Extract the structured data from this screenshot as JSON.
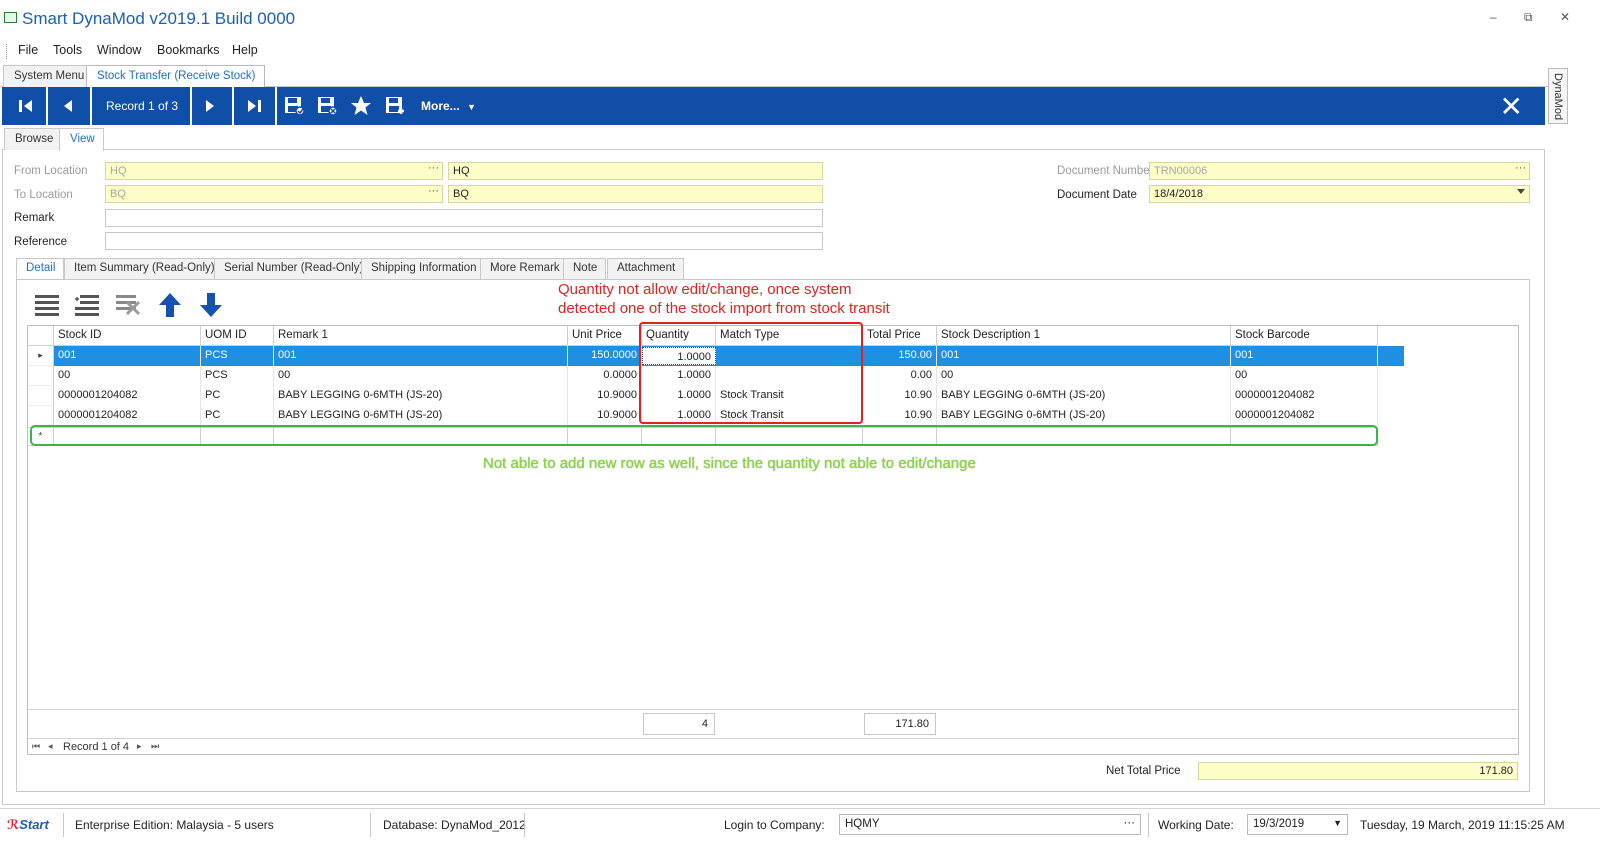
{
  "window": {
    "title": "Smart DynaMod v2019.1 Build 0000",
    "controls": "– ⧉ ✕"
  },
  "menu": [
    "File",
    "Tools",
    "Window",
    "Bookmarks",
    "Help"
  ],
  "doc_tabs": [
    "System Menu",
    "Stock Transfer (Receive Stock)"
  ],
  "side_tab": "DynaMod",
  "toolbar": {
    "record_label": "Record 1 of 3",
    "more_label": "More...",
    "icons": [
      "first-record-icon",
      "prev-record-icon",
      "next-record-icon",
      "last-record-icon",
      "save-icon",
      "save-close-icon",
      "bookmark-star-icon",
      "save-new-icon",
      "close-icon"
    ]
  },
  "view_tabs": [
    "Browse",
    "View"
  ],
  "form": {
    "from_location_label": "From Location",
    "from_location_code": "HQ",
    "from_location_name": "HQ",
    "to_location_label": "To Location",
    "to_location_code": "BQ",
    "to_location_name": "BQ",
    "remark_label": "Remark",
    "remark_value": "",
    "reference_label": "Reference",
    "reference_value": "",
    "doc_number_label": "Document Number",
    "doc_number_value": "TRN00006",
    "doc_date_label": "Document Date",
    "doc_date_value": "18/4/2018"
  },
  "detail_tabs": [
    "Detail",
    "Item Summary (Read-Only)",
    "Serial Number (Read-Only)",
    "Shipping Information",
    "More Remark",
    "Note",
    "Attachment"
  ],
  "grid": {
    "columns": [
      "Stock ID",
      "UOM ID",
      "Remark 1",
      "Unit Price",
      "Quantity",
      "Match Type",
      "Total Price",
      "Stock Description 1",
      "Stock Barcode"
    ],
    "rows": [
      [
        "001",
        "PCS",
        "001",
        "150.0000",
        "1.0000",
        "",
        "150.00",
        "001",
        "001"
      ],
      [
        "00",
        "PCS",
        "00",
        "0.0000",
        "1.0000",
        "",
        "0.00",
        "00",
        "00"
      ],
      [
        "0000001204082",
        "PC",
        "BABY LEGGING 0-6MTH (JS-20)",
        "10.9000",
        "1.0000",
        "Stock Transit",
        "10.90",
        "BABY LEGGING 0-6MTH (JS-20)",
        "0000001204082"
      ],
      [
        "0000001204082",
        "PC",
        "BABY LEGGING 0-6MTH (JS-20)",
        "10.9000",
        "1.0000",
        "Stock Transit",
        "10.90",
        "BABY LEGGING 0-6MTH (JS-20)",
        "0000001204082"
      ]
    ],
    "new_row_marker": "*",
    "selected_marker": "▸",
    "footer_quantity": "4",
    "footer_total": "171.80",
    "nav_record": "Record 1 of 4"
  },
  "annotations": {
    "red_line1": "Quantity not allow edit/change, once system",
    "red_line2": "detected one of the stock import from stock transit",
    "green": "Not able to add new row as well, since the quantity not able to edit/change",
    "red_color": "#e8201c",
    "green_color": "#8bd443"
  },
  "net_total": {
    "label": "Net Total Price",
    "value": "171.80"
  },
  "statusbar": {
    "logo": "Start",
    "edition": "Enterprise Edition: Malaysia - 5 users",
    "database": "Database: DynaMod_2012",
    "login_label": "Login to Company:",
    "company": "HQMY",
    "working_date_label": "Working Date:",
    "working_date": "19/3/2019",
    "datetime": "Tuesday, 19 March, 2019 11:15:25 AM"
  },
  "colors": {
    "toolbar_blue": "#0f4fa8",
    "selection_blue": "#1e8fe1",
    "field_yellow": "#fdfdc8",
    "tab_active_text": "#1f6fc5"
  }
}
